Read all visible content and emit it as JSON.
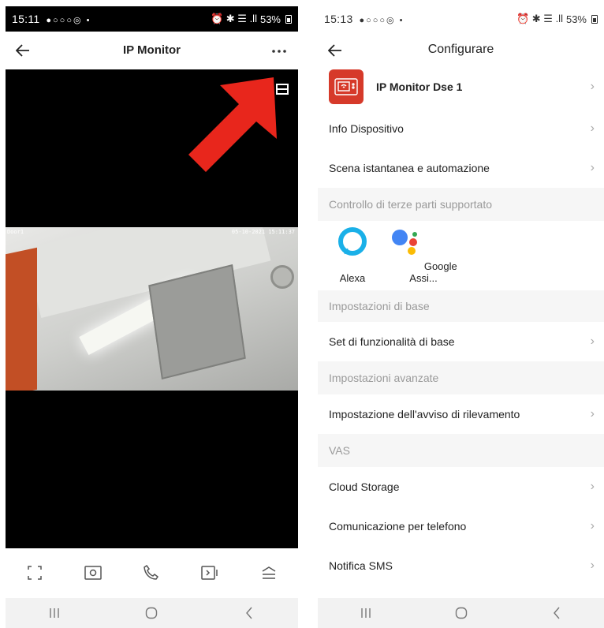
{
  "left_screen": {
    "status": {
      "time": "15:11",
      "icons": "●○○○◎ •",
      "right": "⏰ ✱ ☰ .ll",
      "battery": "53%"
    },
    "header": {
      "title": "IP Monitor"
    },
    "video": {
      "osd_left": "Door1",
      "osd_right": "05-10-2021 15:11:37"
    },
    "toolbar": [
      "fullscreen-icon",
      "snapshot-icon",
      "phone-icon",
      "record-icon",
      "menu-icon"
    ]
  },
  "right_screen": {
    "status": {
      "time": "15:13",
      "icons": "●○○○◎ •",
      "right": "⏰ ✱ ☰ .ll",
      "battery": "53%"
    },
    "header": {
      "title": "Configurare"
    },
    "device": {
      "name": "IP Monitor Dse 1"
    },
    "rows_top": [
      "Info Dispositivo",
      "Scena istantanea e automazione"
    ],
    "section_third": "Controllo di terze parti supportato",
    "third_party": [
      "Alexa",
      "Google Assi..."
    ],
    "section_basic": "Impostazioni di base",
    "row_basic": "Set di funzionalità di base",
    "section_adv": "Impostazioni avanzate",
    "row_adv": "Impostazione dell'avviso di rilevamento",
    "section_vas": "VAS",
    "rows_vas": [
      "Cloud Storage",
      "Comunicazione per telefono",
      "Notifica SMS"
    ]
  },
  "colors": {
    "accent_red": "#d63a2a",
    "arrow_red": "#e8261c"
  }
}
